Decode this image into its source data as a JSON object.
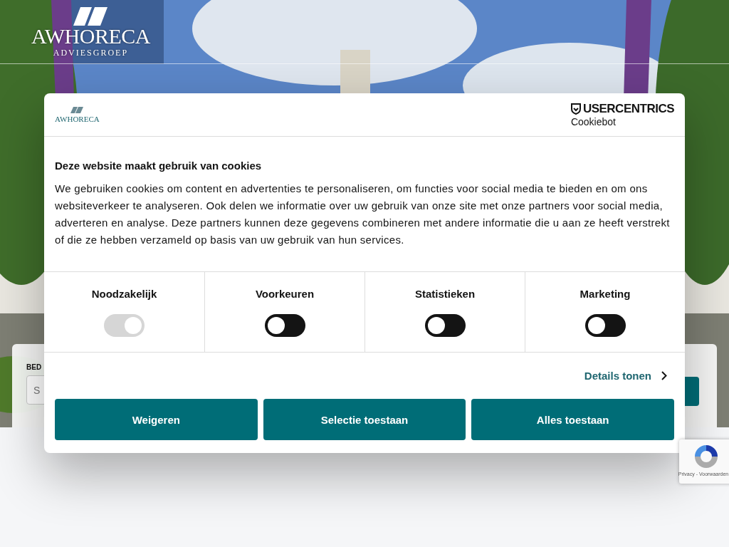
{
  "header": {
    "logo_name": "AWHORECA",
    "logo_tagline": "ADVIESGROEP"
  },
  "search": {
    "label": "BED",
    "placeholder": "S"
  },
  "cookie_dialog": {
    "site_logo": "AWHORECA",
    "provider": "USERCENTRICS",
    "provider_product": "Cookiebot",
    "title": "Deze website maakt gebruik van cookies",
    "body": "We gebruiken cookies om content en advertenties te personaliseren, om functies voor social media te bieden en om ons websiteverkeer te analyseren. Ook delen we informatie over uw gebruik van onze site met onze partners voor social media, adverteren en analyse. Deze partners kunnen deze gegevens combineren met andere informatie die u aan ze heeft verstrekt of die ze hebben verzameld op basis van uw gebruik van hun services.",
    "categories": [
      {
        "label": "Noodzakelijk",
        "on": true,
        "disabled": true
      },
      {
        "label": "Voorkeuren",
        "on": false,
        "disabled": false
      },
      {
        "label": "Statistieken",
        "on": false,
        "disabled": false
      },
      {
        "label": "Marketing",
        "on": false,
        "disabled": false
      }
    ],
    "details_link": "Details tonen",
    "buttons": [
      "Weigeren",
      "Selectie toestaan",
      "Alles toestaan"
    ]
  },
  "recaptcha": {
    "label": "Privacy - Voorwaarden"
  }
}
